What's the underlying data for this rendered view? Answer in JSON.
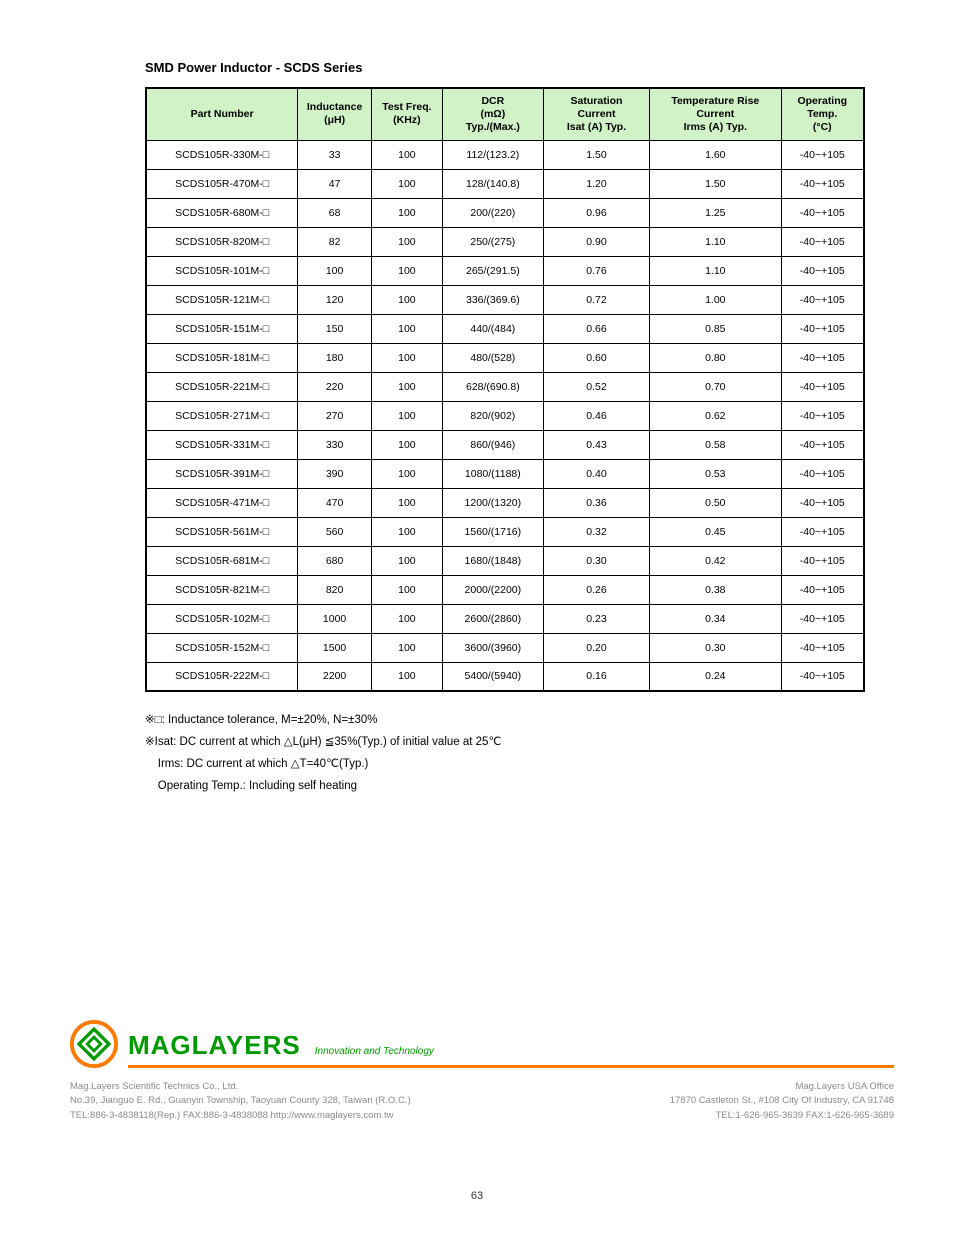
{
  "title": "SMD Power Inductor - SCDS Series",
  "table": {
    "headers": [
      "Part Number",
      "Inductance\n(μH)",
      "Test Freq.\n(KHz)",
      "DCR\n(mΩ)\nTyp./(Max.)",
      "Saturation\nCurrent\nIsat (A) Typ.",
      "Temperature Rise\nCurrent\nIrms (A) Typ.",
      "Operating\nTemp.\n(°C)"
    ],
    "rows": [
      [
        "SCDS105R-330M-□",
        "33",
        "100",
        "112/(123.2)",
        "1.50",
        "1.60",
        "-40~+105"
      ],
      [
        "SCDS105R-470M-□",
        "47",
        "100",
        "128/(140.8)",
        "1.20",
        "1.50",
        "-40~+105"
      ],
      [
        "SCDS105R-680M-□",
        "68",
        "100",
        "200/(220)",
        "0.96",
        "1.25",
        "-40~+105"
      ],
      [
        "SCDS105R-820M-□",
        "82",
        "100",
        "250/(275)",
        "0.90",
        "1.10",
        "-40~+105"
      ],
      [
        "SCDS105R-101M-□",
        "100",
        "100",
        "265/(291.5)",
        "0.76",
        "1.10",
        "-40~+105"
      ],
      [
        "SCDS105R-121M-□",
        "120",
        "100",
        "336/(369.6)",
        "0.72",
        "1.00",
        "-40~+105"
      ],
      [
        "SCDS105R-151M-□",
        "150",
        "100",
        "440/(484)",
        "0.66",
        "0.85",
        "-40~+105"
      ],
      [
        "SCDS105R-181M-□",
        "180",
        "100",
        "480/(528)",
        "0.60",
        "0.80",
        "-40~+105"
      ],
      [
        "SCDS105R-221M-□",
        "220",
        "100",
        "628/(690.8)",
        "0.52",
        "0.70",
        "-40~+105"
      ],
      [
        "SCDS105R-271M-□",
        "270",
        "100",
        "820/(902)",
        "0.46",
        "0.62",
        "-40~+105"
      ],
      [
        "SCDS105R-331M-□",
        "330",
        "100",
        "860/(946)",
        "0.43",
        "0.58",
        "-40~+105"
      ],
      [
        "SCDS105R-391M-□",
        "390",
        "100",
        "1080/(1188)",
        "0.40",
        "0.53",
        "-40~+105"
      ],
      [
        "SCDS105R-471M-□",
        "470",
        "100",
        "1200/(1320)",
        "0.36",
        "0.50",
        "-40~+105"
      ],
      [
        "SCDS105R-561M-□",
        "560",
        "100",
        "1560/(1716)",
        "0.32",
        "0.45",
        "-40~+105"
      ],
      [
        "SCDS105R-681M-□",
        "680",
        "100",
        "1680/(1848)",
        "0.30",
        "0.42",
        "-40~+105"
      ],
      [
        "SCDS105R-821M-□",
        "820",
        "100",
        "2000/(2200)",
        "0.26",
        "0.38",
        "-40~+105"
      ],
      [
        "SCDS105R-102M-□",
        "1000",
        "100",
        "2600/(2860)",
        "0.23",
        "0.34",
        "-40~+105"
      ],
      [
        "SCDS105R-152M-□",
        "1500",
        "100",
        "3600/(3960)",
        "0.20",
        "0.30",
        "-40~+105"
      ],
      [
        "SCDS105R-222M-□",
        "2200",
        "100",
        "5400/(5940)",
        "0.16",
        "0.24",
        "-40~+105"
      ]
    ]
  },
  "notes": {
    "n1": "※□: Inductance tolerance, M=±20%, N=±30%",
    "n2": "※Isat: DC current at which △L(μH) ≦35%(Typ.) of initial value at 25℃",
    "n3": "    Irms: DC current at which △T=40℃(Typ.)",
    "n4": "    Operating Temp.: Including self heating"
  },
  "footer": {
    "brand": "MAGLAYERS",
    "tagline": "Innovation and Technology",
    "address": {
      "tw_title": "Mag.Layers Scientific Technics Co., Ltd.",
      "tw_line": "No.39, Jianguo E. Rd., Guanyin Township, Taoyuan County 328, Taiwan (R.O.C.)",
      "tw_contact": "TEL:886-3-4838118(Rep.)   FAX:886-3-4838088   http://www.maglayers.com.tw",
      "us_title": "Mag.Layers USA Office",
      "us_line": "17870 Castleton St., #108 City Of Industry, CA 91748",
      "us_contact": "TEL:1-626-965-3639   FAX:1-626-965-3689"
    }
  },
  "pagenum": "63"
}
